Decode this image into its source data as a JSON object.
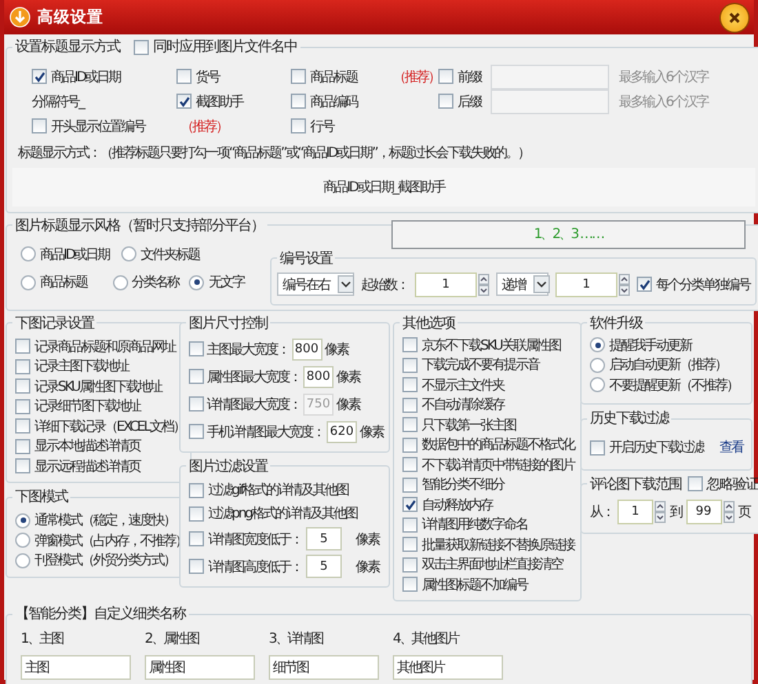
{
  "window": {
    "title": "高级设置"
  },
  "title_display": {
    "legend": "设置标题显示方式",
    "apply_to_filename": {
      "label": "同时应用到图片文件名中",
      "checked": false
    },
    "columns": [
      [
        {
          "kind": "checkbox",
          "label": "商品ID或日期",
          "checked": true
        },
        {
          "kind": "text",
          "label": "分隔符号_"
        },
        {
          "kind": "checkbox",
          "label": "开头显示位置编号",
          "checked": false,
          "tag": "（推荐）"
        }
      ],
      [
        {
          "kind": "checkbox",
          "label": "货号",
          "checked": false
        },
        {
          "kind": "checkbox",
          "label": "截图助手",
          "checked": true
        }
      ],
      [
        {
          "kind": "checkbox",
          "label": "商品标题",
          "checked": false,
          "tag": "（推荐）"
        },
        {
          "kind": "checkbox",
          "label": "商品编码",
          "checked": false
        },
        {
          "kind": "checkbox",
          "label": "行号",
          "checked": false
        }
      ],
      [
        {
          "kind": "affix",
          "label": "前缀",
          "checked": false,
          "hint": "最多输入6个汉字"
        },
        {
          "kind": "affix",
          "label": "后缀",
          "checked": false,
          "hint": "最多输入6个汉字"
        }
      ]
    ],
    "description": "标题显示方式：（推荐标题只要打勾一项“商品标题”或“商品ID或日期”，标题过长会下载失败的。）",
    "preview": "商品ID或日期_截图助手"
  },
  "image_title_style": {
    "legend": "图片标题显示风格（暂时只支持部分平台）",
    "rows": [
      [
        {
          "label": "商品ID或日期",
          "selected": false
        },
        {
          "label": "文件夹标题",
          "selected": false
        }
      ],
      [
        {
          "label": "商品标题",
          "selected": false
        },
        {
          "label": "分类名称",
          "selected": false
        },
        {
          "label": "无文字",
          "selected": true
        }
      ]
    ]
  },
  "numbering": {
    "legend": "编号设置",
    "preview": "1、2、3 ……",
    "position": "编号在右",
    "start_label": "起始数：",
    "start": "1",
    "mode": "递增",
    "step": "1",
    "per_category": {
      "label": "每个分类单独编号",
      "checked": true
    }
  },
  "download_log": {
    "legend": "下图记录设置",
    "options": [
      {
        "label": "记录商品标题和原商品网址",
        "checked": false
      },
      {
        "label": "记录主图下载地址",
        "checked": false
      },
      {
        "label": "记录SKU属性图下载地址",
        "checked": false
      },
      {
        "label": "记录细节图下载地址",
        "checked": false
      },
      {
        "label": "详细下载记录（EXCEL文档）",
        "checked": false
      },
      {
        "label": "显示本地描述详情页",
        "checked": false
      },
      {
        "label": "显示远程描述详情页",
        "checked": false
      }
    ]
  },
  "download_mode": {
    "legend": "下图模式",
    "options": [
      {
        "label": "通常模式（稳定，速度快）",
        "selected": true
      },
      {
        "label": "弹窗模式（占内存，不推荐）",
        "selected": false
      },
      {
        "label": "刊登模式（外贸分类方式）",
        "selected": false
      }
    ]
  },
  "size_control": {
    "legend": "图片尺寸控制",
    "rows": [
      {
        "label": "主图最大宽度：",
        "checked": false,
        "value": "800",
        "unit": "像素",
        "disabled": false
      },
      {
        "label": "属性图最大宽度：",
        "checked": false,
        "value": "800",
        "unit": "像素",
        "disabled": false
      },
      {
        "label": "详情图最大宽度：",
        "checked": false,
        "value": "750",
        "unit": "像素",
        "disabled": true
      },
      {
        "label": "手机详情图最大宽度：",
        "checked": false,
        "value": "620",
        "unit": "像素",
        "disabled": false
      }
    ]
  },
  "image_filter": {
    "legend": "图片过滤设置",
    "rows": [
      {
        "kind": "checkbox",
        "label": "过滤gif格式的详情及其他图",
        "checked": false
      },
      {
        "kind": "checkbox",
        "label": "过滤png格式的详情及其他图",
        "checked": false
      },
      {
        "kind": "threshold",
        "label": "详情图宽度低于：",
        "checked": false,
        "value": "5",
        "unit": "像素"
      },
      {
        "kind": "threshold",
        "label": "详情图高度低于：",
        "checked": false,
        "value": "5",
        "unit": "像素"
      }
    ]
  },
  "other_options": {
    "legend": "其他选项",
    "options": [
      {
        "label": "京东不下载SKU关联属性图",
        "checked": false
      },
      {
        "label": "下载完成不要有提示音",
        "checked": false
      },
      {
        "label": "不显示主文件夹",
        "checked": false
      },
      {
        "label": "不自动清除缓存",
        "checked": false
      },
      {
        "label": "只下载第一张主图",
        "checked": false
      },
      {
        "label": "数据包中的商品标题不格式化",
        "checked": false
      },
      {
        "label": "不下载详情页中带链接的图片",
        "checked": false
      },
      {
        "label": "智能分类不细分",
        "checked": false
      },
      {
        "label": "自动释放内存",
        "checked": true
      },
      {
        "label": "详情图用纯数字命名",
        "checked": false
      },
      {
        "label": "批量获取新链接不替换原链接",
        "checked": false
      },
      {
        "label": "双击主界面地址栏直接清空",
        "checked": false
      },
      {
        "label": "属性图标题不加编号",
        "checked": false
      }
    ]
  },
  "software_upgrade": {
    "legend": "软件升级",
    "options": [
      {
        "label": "提醒我手动更新",
        "selected": true
      },
      {
        "label": "启动自动更新（推荐）",
        "selected": false
      },
      {
        "label": "不要提醒更新（不推荐）",
        "selected": false
      }
    ]
  },
  "history_filter": {
    "legend": "历史下载过滤",
    "option": {
      "label": "开启历史下载过滤",
      "checked": false
    },
    "link": "查看"
  },
  "review_range": {
    "legend": "评论图下载范围",
    "ignore": {
      "label": "忽略验证",
      "checked": false
    },
    "from_label": "从：",
    "from": "1",
    "to_label": "到",
    "to": "99",
    "unit": "页"
  },
  "custom_names": {
    "legend": "【智能分类】自定义细类名称",
    "items": [
      {
        "label": "1、主图",
        "value": "主图"
      },
      {
        "label": "2、属性图",
        "value": "属性图"
      },
      {
        "label": "3、详情图",
        "value": "细节图"
      },
      {
        "label": "4、其他图片",
        "value": "其他图片"
      }
    ]
  }
}
